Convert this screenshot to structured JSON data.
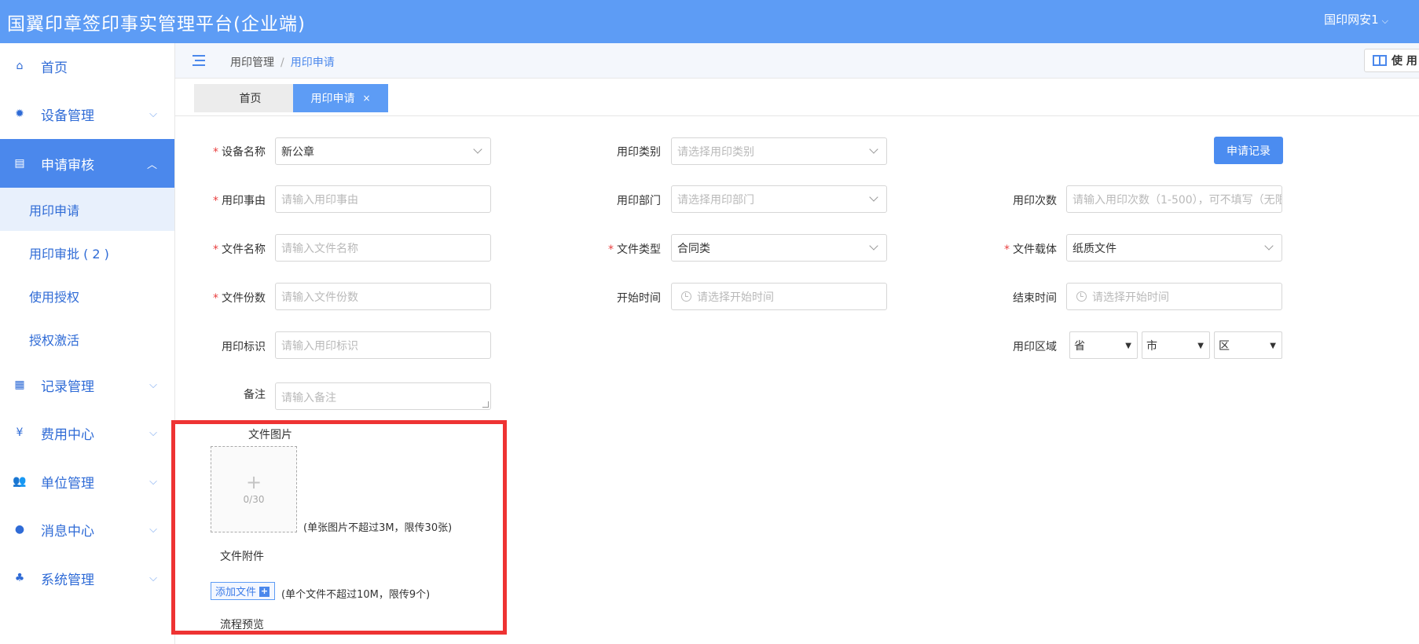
{
  "app": {
    "title": "国翼印章签印事实管理平台(企业端)",
    "user": "国印网安1"
  },
  "sidebar": {
    "items": [
      {
        "label": "首页",
        "icon": "home-icon"
      },
      {
        "label": "设备管理",
        "icon": "gear-icon"
      },
      {
        "label": "申请审核",
        "icon": "document-icon"
      },
      {
        "label": "记录管理",
        "icon": "record-icon"
      },
      {
        "label": "费用中心",
        "icon": "yen-icon"
      },
      {
        "label": "单位管理",
        "icon": "users-icon"
      },
      {
        "label": "消息中心",
        "icon": "chat-icon"
      },
      {
        "label": "系统管理",
        "icon": "org-chart-icon"
      }
    ],
    "sub_items": [
      "用印申请",
      "用印审批 ( 2 )",
      "使用授权",
      "授权激活"
    ]
  },
  "breadcrumb": {
    "parent": "用印管理",
    "separator": "/",
    "current": "用印申请"
  },
  "help_button": "使 用",
  "tabs": {
    "home": "首页",
    "current": "用印申请",
    "close": "×"
  },
  "form": {
    "device_name": {
      "label": "设备名称",
      "value": "新公章"
    },
    "seal_type": {
      "label": "用印类别",
      "placeholder": "请选择用印类别"
    },
    "reason": {
      "label": "用印事由",
      "placeholder": "请输入用印事由"
    },
    "department": {
      "label": "用印部门",
      "placeholder": "请选择用印部门"
    },
    "times": {
      "label": "用印次数",
      "placeholder": "请输入用印次数（1-500），可不填写（无限"
    },
    "file_name": {
      "label": "文件名称",
      "placeholder": "请输入文件名称"
    },
    "file_type": {
      "label": "文件类型",
      "value": "合同类"
    },
    "file_carrier": {
      "label": "文件载体",
      "value": "纸质文件"
    },
    "copies": {
      "label": "文件份数",
      "placeholder": "请输入文件份数"
    },
    "start_time": {
      "label": "开始时间",
      "placeholder": "请选择开始时间"
    },
    "end_time": {
      "label": "结束时间",
      "placeholder": "请选择开始时间"
    },
    "mark": {
      "label": "用印标识",
      "placeholder": "请输入用印标识"
    },
    "region": {
      "label": "用印区域",
      "province": "省",
      "city": "市",
      "district": "区"
    },
    "remark": {
      "label": "备注",
      "placeholder": "请输入备注"
    },
    "required_mark": "*"
  },
  "record_button": "申请记录",
  "upload": {
    "images_label": "文件图片",
    "count": "0/30",
    "image_hint": "(单张图片不超过3M，限传30张)",
    "attachments_label": "文件附件",
    "add_file": "添加文件",
    "file_hint": "(单个文件不超过10M，限传9个)",
    "flow_preview": "流程预览"
  },
  "colors": {
    "header": "#5d9cf5",
    "accent": "#4b88ec",
    "required": "#e94040",
    "highlight": "#ee3333"
  }
}
